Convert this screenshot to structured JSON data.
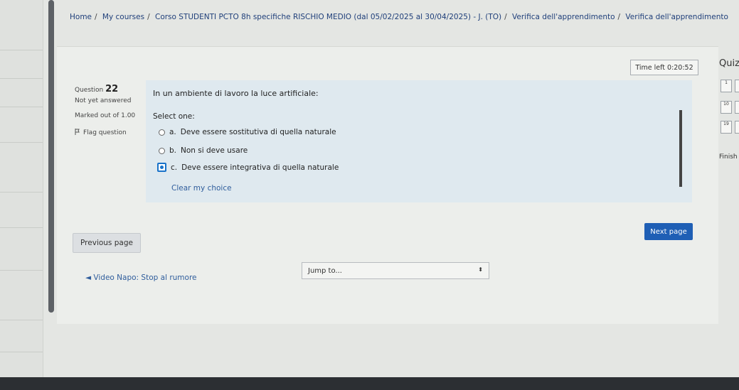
{
  "breadcrumb": {
    "items": [
      "Home",
      "My courses",
      "Corso STUDENTI PCTO 8h specifiche RISCHIO MEDIO (dal 05/02/2025 al 30/04/2025) - J. (TO)",
      "Verifica dell'apprendimento",
      "Verifica dell'apprendimento"
    ],
    "separator": "/"
  },
  "timer": {
    "label": "Time left 0:20:52"
  },
  "question": {
    "label": "Question",
    "number": "22",
    "state": "Not yet answered",
    "marks": "Marked out of 1.00",
    "flag_label": "Flag question",
    "text": "In un ambiente di lavoro la luce artificiale:",
    "select_one": "Select one:",
    "answers": [
      {
        "letter": "a.",
        "text": "Deve essere sostitutiva di quella naturale"
      },
      {
        "letter": "b.",
        "text": "Non si deve usare"
      },
      {
        "letter": "c.",
        "text": "Deve essere integrativa di quella naturale"
      }
    ],
    "clear_choice": "Clear my choice"
  },
  "navigation": {
    "previous_page": "Previous page",
    "next_page": "Next page",
    "previous_activity": "◄ Video Napo: Stop al rumore",
    "jump_placeholder": "Jump to..."
  },
  "quiz_nav": {
    "title": "Quiz",
    "buttons": [
      "1",
      "10",
      "19"
    ],
    "finish": "Finish"
  },
  "colors": {
    "accent": "#1f5fb5",
    "link": "#2f5d9c",
    "question_bg": "#dfe9ef"
  }
}
